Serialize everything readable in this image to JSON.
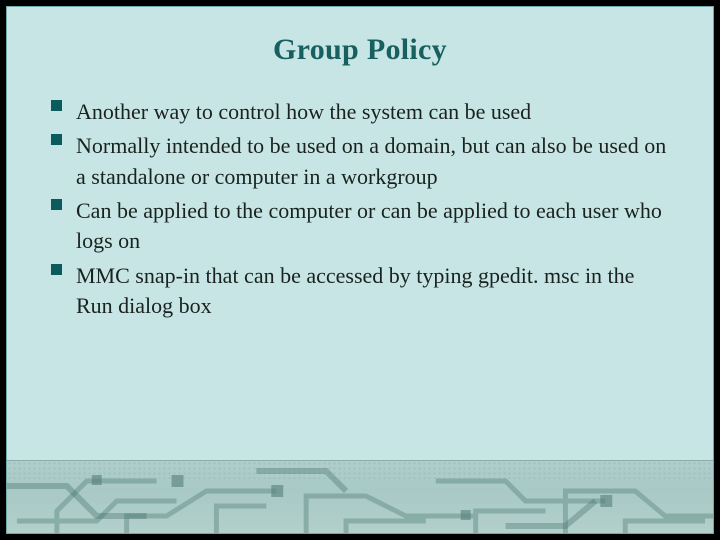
{
  "title": "Group Policy",
  "bullets": [
    "Another way to control how the system can be used",
    "Normally intended to be used on a domain, but can also be used on a standalone or computer in a workgroup",
    "Can be applied to the computer or can be applied to each user who logs on",
    "MMC snap-in that can be accessed by typing gpedit. msc in the Run dialog box"
  ],
  "colors": {
    "background": "#c7e5e4",
    "title": "#17605f",
    "bullet_square": "#0a5c5c",
    "outer_border": "#000000"
  }
}
